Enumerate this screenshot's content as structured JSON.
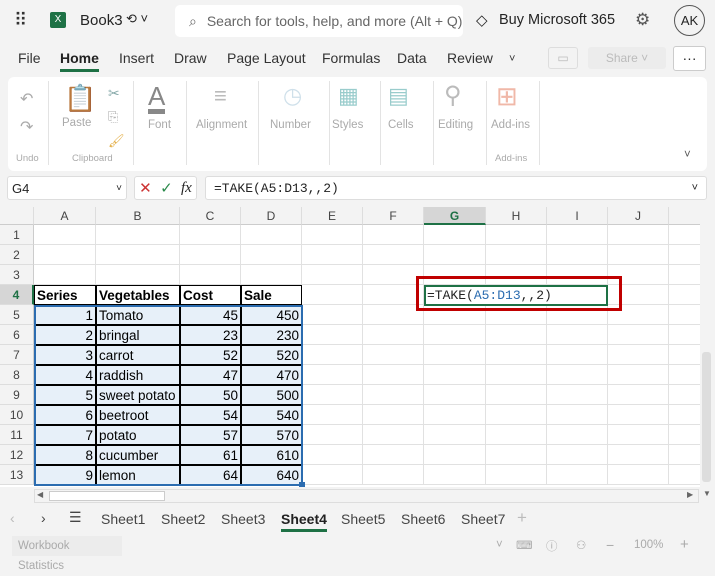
{
  "title_bar": {
    "workbook": "Book3",
    "search_placeholder": "Search for tools, help, and more (Alt + Q)",
    "buy": "Buy Microsoft 365",
    "avatar": "AK"
  },
  "menu": [
    "File",
    "Home",
    "Insert",
    "Draw",
    "Page Layout",
    "Formulas",
    "Data",
    "Review"
  ],
  "share": "Share",
  "ribbon": {
    "groups": [
      "Paste",
      "Font",
      "Alignment",
      "Number",
      "Styles",
      "Cells",
      "Editing",
      "Add-ins"
    ],
    "group_labels": [
      "Undo",
      "Clipboard",
      "Add-ins"
    ]
  },
  "formula_bar": {
    "name_box": "G4",
    "formula": "=TAKE(A5:D13,,2)",
    "fx": "fx"
  },
  "columns": [
    "A",
    "B",
    "C",
    "D",
    "E",
    "F",
    "G",
    "H",
    "I",
    "J"
  ],
  "rows": [
    "1",
    "2",
    "3",
    "4",
    "5",
    "6",
    "7",
    "8",
    "9",
    "10",
    "11",
    "12",
    "13"
  ],
  "table": {
    "headers": [
      "Series",
      "Vegetables",
      "Cost",
      "Sale"
    ],
    "rows": [
      [
        "1",
        "Tomato",
        "45",
        "450"
      ],
      [
        "2",
        "bringal",
        "23",
        "230"
      ],
      [
        "3",
        "carrot",
        "52",
        "520"
      ],
      [
        "4",
        "raddish",
        "47",
        "470"
      ],
      [
        "5",
        "sweet potato",
        "50",
        "500"
      ],
      [
        "6",
        "beetroot",
        "54",
        "540"
      ],
      [
        "7",
        "potato",
        "57",
        "570"
      ],
      [
        "8",
        "cucumber",
        "61",
        "610"
      ],
      [
        "9",
        "lemon",
        "64",
        "640"
      ]
    ]
  },
  "active_cell": {
    "ref": "G4",
    "text_prefix": "=TAKE(",
    "range": "A5:D13",
    "text_suffix": ",,2)"
  },
  "sheets": [
    "Sheet1",
    "Sheet2",
    "Sheet3",
    "Sheet4",
    "Sheet5",
    "Sheet6",
    "Sheet7"
  ],
  "active_sheet": "Sheet4",
  "status": {
    "label": "Workbook Statistics",
    "zoom": "100%"
  },
  "colors": {
    "accent": "#1e7145",
    "highlight": "#c00000",
    "range_blue": "#2b6cb0"
  }
}
